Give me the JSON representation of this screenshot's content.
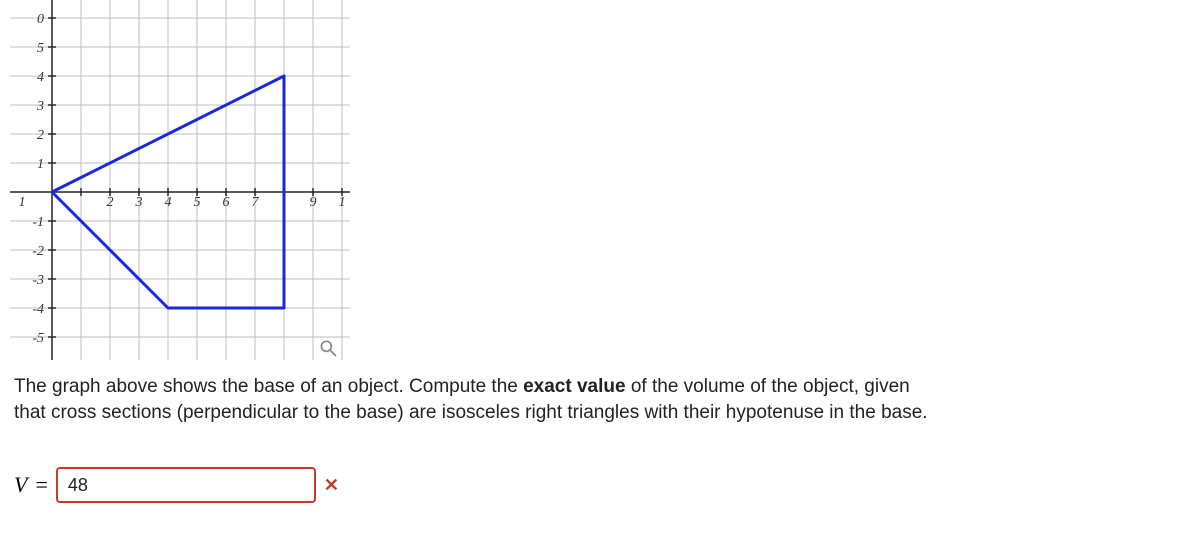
{
  "chart_data": {
    "type": "line",
    "title": "",
    "xlabel": "",
    "ylabel": "",
    "xlim": [
      -1,
      10
    ],
    "ylim": [
      -6,
      6
    ],
    "grid": true,
    "x_ticks_visible": [
      "0",
      "5",
      "4",
      "3",
      "2",
      "1",
      "1",
      "-1",
      "-2",
      "-3",
      "-4",
      "-5",
      "2",
      "3",
      "4",
      "5",
      "6",
      "7",
      "9",
      "1"
    ],
    "shape": {
      "description": "Triangle base polygon",
      "vertices": [
        [
          0,
          0
        ],
        [
          8,
          4
        ],
        [
          8,
          -4
        ],
        [
          0,
          0
        ]
      ],
      "with_segment": [
        [
          4,
          -4
        ],
        [
          8,
          -4
        ]
      ]
    }
  },
  "problem": {
    "line1_a": "The graph above shows the base of an object. Compute the ",
    "line1_strong": "exact value",
    "line1_b": " of the volume of the object, given",
    "line2": "that cross sections (perpendicular to the base) are isosceles right triangles with their hypotenuse in the base."
  },
  "answer": {
    "var": "V",
    "eq": "=",
    "value": "48",
    "status": "incorrect"
  },
  "icons": {
    "magnifier": "magnifier-icon",
    "x": "✕"
  }
}
